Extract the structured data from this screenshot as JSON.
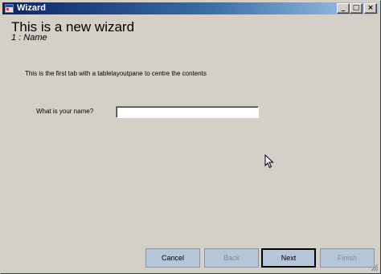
{
  "window": {
    "title": "Wizard",
    "minimize_glyph": "_",
    "maximize_glyph": "□",
    "close_glyph": "×"
  },
  "wizard": {
    "heading": "This is a new wizard",
    "step": "1 : Name",
    "description": "This is the first tab with a tablelayoutpane to centre the contents"
  },
  "form": {
    "name_label": "What is your name?",
    "name_value": ""
  },
  "buttons": {
    "cancel": "Cancel",
    "back": "Back",
    "next": "Next",
    "finish": "Finish"
  },
  "colors": {
    "titlebar_start": "#0a246a",
    "titlebar_end": "#a6caf0",
    "button_face": "#b6c6d9",
    "window_face": "#d4d0c8"
  }
}
